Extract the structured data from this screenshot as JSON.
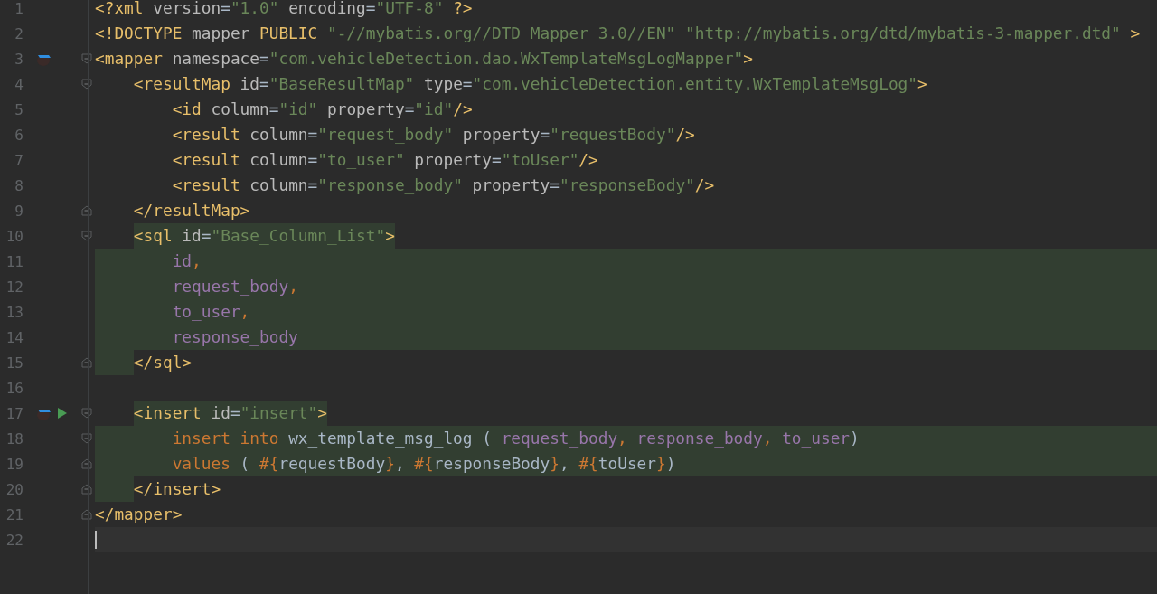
{
  "lines": [
    {
      "number": "1",
      "tokens": [
        {
          "text": "<?xml ",
          "kind": "tag"
        },
        {
          "text": "version",
          "kind": "attr"
        },
        {
          "text": "=",
          "kind": "plain"
        },
        {
          "text": "\"1.0\"",
          "kind": "string"
        },
        {
          "text": " encoding",
          "kind": "attr"
        },
        {
          "text": "=",
          "kind": "plain"
        },
        {
          "text": "\"UTF-8\"",
          "kind": "string"
        },
        {
          "text": " ?>",
          "kind": "tag"
        }
      ]
    },
    {
      "number": "2",
      "tokens": [
        {
          "text": "<!DOCTYPE ",
          "kind": "tag"
        },
        {
          "text": "mapper ",
          "kind": "attr"
        },
        {
          "text": "PUBLIC ",
          "kind": "tag"
        },
        {
          "text": "\"-//mybatis.org//DTD Mapper 3.0//EN\"",
          "kind": "string"
        },
        {
          "text": " \"http://mybatis.org/dtd/mybatis-3-mapper.dtd\"",
          "kind": "string"
        },
        {
          "text": " >",
          "kind": "tag"
        }
      ]
    },
    {
      "number": "3",
      "mapper_icon": true,
      "fold_start": true,
      "tokens": [
        {
          "text": "<mapper ",
          "kind": "tag"
        },
        {
          "text": "namespace",
          "kind": "attr"
        },
        {
          "text": "=",
          "kind": "plain"
        },
        {
          "text": "\"com.vehicleDetection.dao.WxTemplateMsgLogMapper\"",
          "kind": "string"
        },
        {
          "text": ">",
          "kind": "tag"
        }
      ]
    },
    {
      "number": "4",
      "fold_start": true,
      "tokens": [
        {
          "text": "    <resultMap ",
          "kind": "tag"
        },
        {
          "text": "id",
          "kind": "attr"
        },
        {
          "text": "=",
          "kind": "plain"
        },
        {
          "text": "\"BaseResultMap\"",
          "kind": "string"
        },
        {
          "text": " type",
          "kind": "attr"
        },
        {
          "text": "=",
          "kind": "plain"
        },
        {
          "text": "\"com.vehicleDetection.entity.WxTemplateMsgLog\"",
          "kind": "string"
        },
        {
          "text": ">",
          "kind": "tag"
        }
      ]
    },
    {
      "number": "5",
      "tokens": [
        {
          "text": "        <id ",
          "kind": "tag"
        },
        {
          "text": "column",
          "kind": "attr"
        },
        {
          "text": "=",
          "kind": "plain"
        },
        {
          "text": "\"id\"",
          "kind": "string"
        },
        {
          "text": " property",
          "kind": "attr"
        },
        {
          "text": "=",
          "kind": "plain"
        },
        {
          "text": "\"id\"",
          "kind": "string"
        },
        {
          "text": "/>",
          "kind": "tag"
        }
      ]
    },
    {
      "number": "6",
      "tokens": [
        {
          "text": "        <result ",
          "kind": "tag"
        },
        {
          "text": "column",
          "kind": "attr"
        },
        {
          "text": "=",
          "kind": "plain"
        },
        {
          "text": "\"request_body\"",
          "kind": "string"
        },
        {
          "text": " property",
          "kind": "attr"
        },
        {
          "text": "=",
          "kind": "plain"
        },
        {
          "text": "\"requestBody\"",
          "kind": "string"
        },
        {
          "text": "/>",
          "kind": "tag"
        }
      ]
    },
    {
      "number": "7",
      "tokens": [
        {
          "text": "        <result ",
          "kind": "tag"
        },
        {
          "text": "column",
          "kind": "attr"
        },
        {
          "text": "=",
          "kind": "plain"
        },
        {
          "text": "\"to_user\"",
          "kind": "string"
        },
        {
          "text": " property",
          "kind": "attr"
        },
        {
          "text": "=",
          "kind": "plain"
        },
        {
          "text": "\"toUser\"",
          "kind": "string"
        },
        {
          "text": "/>",
          "kind": "tag"
        }
      ]
    },
    {
      "number": "8",
      "tokens": [
        {
          "text": "        <result ",
          "kind": "tag"
        },
        {
          "text": "column",
          "kind": "attr"
        },
        {
          "text": "=",
          "kind": "plain"
        },
        {
          "text": "\"response_body\"",
          "kind": "string"
        },
        {
          "text": " property",
          "kind": "attr"
        },
        {
          "text": "=",
          "kind": "plain"
        },
        {
          "text": "\"responseBody\"",
          "kind": "string"
        },
        {
          "text": "/>",
          "kind": "tag"
        }
      ]
    },
    {
      "number": "9",
      "fold_end": true,
      "tokens": [
        {
          "text": "    </resultMap>",
          "kind": "tag"
        }
      ]
    },
    {
      "number": "10",
      "fold_start": true,
      "sql_open": true,
      "tokens": [
        {
          "text": "    <sql ",
          "kind": "tag"
        },
        {
          "text": "id",
          "kind": "attr"
        },
        {
          "text": "=",
          "kind": "plain"
        },
        {
          "text": "\"Base_Column_List\"",
          "kind": "string"
        },
        {
          "text": ">",
          "kind": "tag"
        }
      ]
    },
    {
      "number": "11",
      "sql_body": true,
      "tokens": [
        {
          "text": "        id",
          "kind": "column"
        },
        {
          "text": ",",
          "kind": "keyword"
        }
      ]
    },
    {
      "number": "12",
      "sql_body": true,
      "tokens": [
        {
          "text": "        request_body",
          "kind": "column"
        },
        {
          "text": ",",
          "kind": "keyword"
        }
      ]
    },
    {
      "number": "13",
      "sql_body": true,
      "tokens": [
        {
          "text": "        to_user",
          "kind": "column"
        },
        {
          "text": ",",
          "kind": "keyword"
        }
      ]
    },
    {
      "number": "14",
      "sql_body": true,
      "tokens": [
        {
          "text": "        response_body",
          "kind": "column"
        }
      ]
    },
    {
      "number": "15",
      "fold_end": true,
      "sql_close": true,
      "tokens": [
        {
          "text": "    </sql>",
          "kind": "tag"
        }
      ]
    },
    {
      "number": "16"
    },
    {
      "number": "17",
      "mapper_icon": true,
      "run_icon": true,
      "fold_start": true,
      "sql_open": true,
      "tokens": [
        {
          "text": "    <insert ",
          "kind": "tag"
        },
        {
          "text": "id",
          "kind": "attr"
        },
        {
          "text": "=",
          "kind": "plain"
        },
        {
          "text": "\"insert\"",
          "kind": "string"
        },
        {
          "text": ">",
          "kind": "tag"
        }
      ]
    },
    {
      "number": "18",
      "fold_start": true,
      "sql_body": true,
      "tokens": [
        {
          "text": "        insert into ",
          "kind": "keyword"
        },
        {
          "text": "wx_template_msg_log ( ",
          "kind": "plain"
        },
        {
          "text": "request_body",
          "kind": "column"
        },
        {
          "text": ", ",
          "kind": "keyword"
        },
        {
          "text": "response_body",
          "kind": "column"
        },
        {
          "text": ", ",
          "kind": "keyword"
        },
        {
          "text": "to_user",
          "kind": "column"
        },
        {
          "text": ")",
          "kind": "plain"
        }
      ]
    },
    {
      "number": "19",
      "fold_end": true,
      "sql_body": true,
      "tokens": [
        {
          "text": "        values ",
          "kind": "keyword"
        },
        {
          "text": "( ",
          "kind": "plain"
        },
        {
          "text": "#{",
          "kind": "keyword"
        },
        {
          "text": "requestBody",
          "kind": "plain"
        },
        {
          "text": "}",
          "kind": "keyword"
        },
        {
          "text": ", ",
          "kind": "plain"
        },
        {
          "text": "#{",
          "kind": "keyword"
        },
        {
          "text": "responseBody",
          "kind": "plain"
        },
        {
          "text": "}",
          "kind": "keyword"
        },
        {
          "text": ", ",
          "kind": "plain"
        },
        {
          "text": "#{",
          "kind": "keyword"
        },
        {
          "text": "toUser",
          "kind": "plain"
        },
        {
          "text": "}",
          "kind": "keyword"
        },
        {
          "text": ")",
          "kind": "plain"
        }
      ]
    },
    {
      "number": "20",
      "fold_end": true,
      "sql_close": true,
      "tokens": [
        {
          "text": "    </insert>",
          "kind": "tag"
        }
      ]
    },
    {
      "number": "21",
      "fold_end": true,
      "tokens": [
        {
          "text": "</mapper>",
          "kind": "tag"
        }
      ]
    },
    {
      "number": "22",
      "current": true
    }
  ]
}
